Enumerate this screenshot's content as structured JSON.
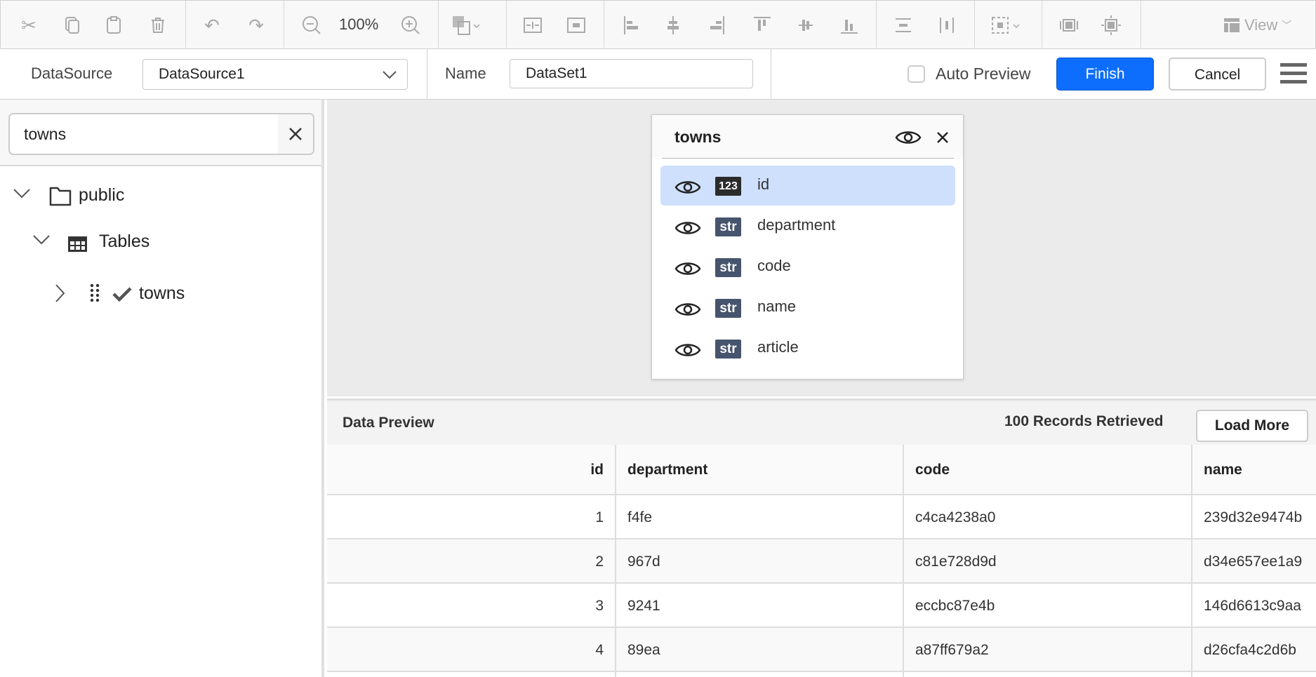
{
  "toolbar": {
    "zoom_level": "100%",
    "view_label": "View",
    "icons": [
      "scissors-icon",
      "copy-icon",
      "paste-icon",
      "delete-icon",
      "undo-icon",
      "redo-icon",
      "zoom-out-icon",
      "zoom-in-icon",
      "fill-icon",
      "split-horizontal-icon",
      "split-vertical-icon",
      "align-left-icon",
      "align-center-icon",
      "align-right-icon",
      "align-top-icon",
      "align-middle-icon",
      "align-bottom-icon",
      "distribute-vertical-icon",
      "distribute-horizontal-icon",
      "selection-icon",
      "fit-width-icon",
      "fit-page-icon",
      "view-icon"
    ]
  },
  "dataset_bar": {
    "datasource_label": "DataSource",
    "datasource_value": "DataSource1",
    "name_label": "Name",
    "name_value": "DataSet1",
    "auto_preview_label": "Auto Preview",
    "auto_preview_checked": false,
    "finish_label": "Finish",
    "cancel_label": "Cancel",
    "accent_color": "#0d6efd"
  },
  "sidebar": {
    "search_value": "towns",
    "tree": [
      {
        "label": "public",
        "icon": "folder-icon",
        "expanded": true
      },
      {
        "label": "Tables",
        "icon": "table-icon",
        "expanded": true
      },
      {
        "label": "towns",
        "icon": "check-icon",
        "expanded": false
      }
    ]
  },
  "field_panel": {
    "title": "towns",
    "fields": [
      {
        "type": "123",
        "name": "id",
        "selected": true
      },
      {
        "type": "str",
        "name": "department",
        "selected": false
      },
      {
        "type": "str",
        "name": "code",
        "selected": false
      },
      {
        "type": "str",
        "name": "name",
        "selected": false
      },
      {
        "type": "str",
        "name": "article",
        "selected": false
      }
    ]
  },
  "preview": {
    "title": "Data Preview",
    "records_label": "100 Records Retrieved",
    "load_more_label": "Load More",
    "columns": [
      "id",
      "department",
      "code",
      "name"
    ],
    "rows": [
      [
        "1",
        "f4fe",
        "c4ca4238a0",
        "239d32e9474b"
      ],
      [
        "2",
        "967d",
        "c81e728d9d",
        "d34e657ee1a9"
      ],
      [
        "3",
        "9241",
        "eccbc87e4b",
        "146d6613c9aa"
      ],
      [
        "4",
        "89ea",
        "a87ff679a2",
        "d26cfa4c2d6b"
      ]
    ]
  }
}
